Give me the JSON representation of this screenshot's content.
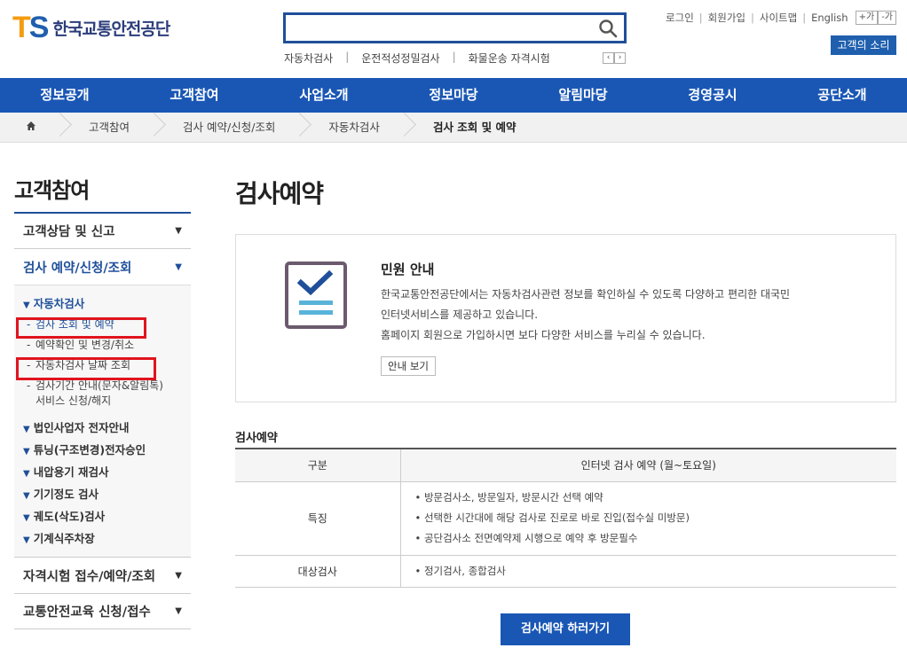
{
  "header": {
    "logo_ts": "TS",
    "logo_name": "한국교통안전공단",
    "search": {
      "value": "",
      "placeholder": ""
    },
    "quick_links": [
      "자동차검사",
      "운전적성정밀검사",
      "화물운송 자격시험"
    ],
    "util": {
      "login": "로그인",
      "join": "회원가입",
      "sitemap": "사이트맵",
      "english": "English",
      "font_plus": "+가",
      "font_minus": "-가"
    },
    "voice_button": "고객의 소리"
  },
  "gnb": [
    "정보공개",
    "고객참여",
    "사업소개",
    "정보마당",
    "알림마당",
    "경영공시",
    "공단소개"
  ],
  "breadcrumb": [
    "고객참여",
    "검사 예약/신청/조회",
    "자동차검사",
    "검사 조회 및 예약"
  ],
  "sidebar": {
    "title": "고객참여",
    "menu_top": "고객상담 및 신고",
    "menu_active": "검사 예약/신청/조회",
    "sub_active": "자동차검사",
    "sub_items": [
      "검사 조회 및 예약",
      "예약확인 및 변경/취소",
      "자동차검사 날짜 조회"
    ],
    "sub_item4_line1": "검사기간 안내(문자&알림톡)",
    "sub_item4_line2": "서비스 신청/해지",
    "groups": [
      "법인사업자 전자안내",
      "튜닝(구조변경)전자승인",
      "내압용기 재검사",
      "기기정도 검사",
      "궤도(삭도)검사",
      "기계식주차장"
    ],
    "menu_bottom1": "자격시험 접수/예약/조회",
    "menu_bottom2": "교통안전교육 신청/접수"
  },
  "content": {
    "page_title": "검사예약",
    "notice": {
      "title": "민원 안내",
      "line1": "한국교통안전공단에서는 자동차검사관련 정보를 확인하실 수 있도록 다양하고 편리한 대국민",
      "line2": "인터넷서비스를 제공하고 있습니다.",
      "line3": "홈페이지 회원으로 가입하시면 보다 다양한 서비스를 누리실 수 있습니다.",
      "button": "안내 보기"
    },
    "section_title": "검사예약",
    "table": {
      "headers": [
        "구분",
        "인터넷 검사 예약 (월~토요일)"
      ],
      "row1_label": "특징",
      "row1_items": [
        "• 방문검사소, 방문일자, 방문시간 선택 예약",
        "• 선택한 시간대에 해당 검사로 진로로 바로 진입(접수실 미방문)",
        "• 공단검사소 전면예약제 시행으로 예약 후 방문필수"
      ],
      "row2_label": "대상검사",
      "row2_items": [
        "• 정기검사, 종합검사"
      ]
    },
    "go_button": "검사예약 하러가기"
  },
  "colors": {
    "primary": "#1a57b5",
    "logo_orange": "#f39c12",
    "highlight": "#e0141e"
  }
}
